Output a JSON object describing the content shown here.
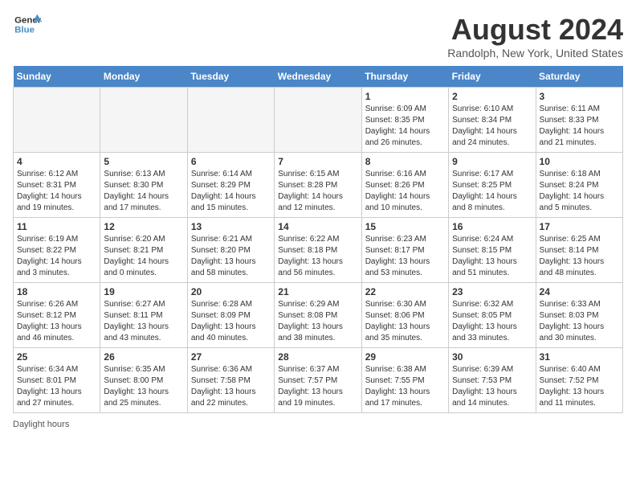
{
  "header": {
    "logo_line1": "General",
    "logo_line2": "Blue",
    "month_title": "August 2024",
    "location": "Randolph, New York, United States"
  },
  "days_of_week": [
    "Sunday",
    "Monday",
    "Tuesday",
    "Wednesday",
    "Thursday",
    "Friday",
    "Saturday"
  ],
  "weeks": [
    [
      {
        "day": "",
        "empty": true
      },
      {
        "day": "",
        "empty": true
      },
      {
        "day": "",
        "empty": true
      },
      {
        "day": "",
        "empty": true
      },
      {
        "day": "1",
        "sunrise": "6:09 AM",
        "sunset": "8:35 PM",
        "daylight": "14 hours and 26 minutes."
      },
      {
        "day": "2",
        "sunrise": "6:10 AM",
        "sunset": "8:34 PM",
        "daylight": "14 hours and 24 minutes."
      },
      {
        "day": "3",
        "sunrise": "6:11 AM",
        "sunset": "8:33 PM",
        "daylight": "14 hours and 21 minutes."
      }
    ],
    [
      {
        "day": "4",
        "sunrise": "6:12 AM",
        "sunset": "8:31 PM",
        "daylight": "14 hours and 19 minutes."
      },
      {
        "day": "5",
        "sunrise": "6:13 AM",
        "sunset": "8:30 PM",
        "daylight": "14 hours and 17 minutes."
      },
      {
        "day": "6",
        "sunrise": "6:14 AM",
        "sunset": "8:29 PM",
        "daylight": "14 hours and 15 minutes."
      },
      {
        "day": "7",
        "sunrise": "6:15 AM",
        "sunset": "8:28 PM",
        "daylight": "14 hours and 12 minutes."
      },
      {
        "day": "8",
        "sunrise": "6:16 AM",
        "sunset": "8:26 PM",
        "daylight": "14 hours and 10 minutes."
      },
      {
        "day": "9",
        "sunrise": "6:17 AM",
        "sunset": "8:25 PM",
        "daylight": "14 hours and 8 minutes."
      },
      {
        "day": "10",
        "sunrise": "6:18 AM",
        "sunset": "8:24 PM",
        "daylight": "14 hours and 5 minutes."
      }
    ],
    [
      {
        "day": "11",
        "sunrise": "6:19 AM",
        "sunset": "8:22 PM",
        "daylight": "14 hours and 3 minutes."
      },
      {
        "day": "12",
        "sunrise": "6:20 AM",
        "sunset": "8:21 PM",
        "daylight": "14 hours and 0 minutes."
      },
      {
        "day": "13",
        "sunrise": "6:21 AM",
        "sunset": "8:20 PM",
        "daylight": "13 hours and 58 minutes."
      },
      {
        "day": "14",
        "sunrise": "6:22 AM",
        "sunset": "8:18 PM",
        "daylight": "13 hours and 56 minutes."
      },
      {
        "day": "15",
        "sunrise": "6:23 AM",
        "sunset": "8:17 PM",
        "daylight": "13 hours and 53 minutes."
      },
      {
        "day": "16",
        "sunrise": "6:24 AM",
        "sunset": "8:15 PM",
        "daylight": "13 hours and 51 minutes."
      },
      {
        "day": "17",
        "sunrise": "6:25 AM",
        "sunset": "8:14 PM",
        "daylight": "13 hours and 48 minutes."
      }
    ],
    [
      {
        "day": "18",
        "sunrise": "6:26 AM",
        "sunset": "8:12 PM",
        "daylight": "13 hours and 46 minutes."
      },
      {
        "day": "19",
        "sunrise": "6:27 AM",
        "sunset": "8:11 PM",
        "daylight": "13 hours and 43 minutes."
      },
      {
        "day": "20",
        "sunrise": "6:28 AM",
        "sunset": "8:09 PM",
        "daylight": "13 hours and 40 minutes."
      },
      {
        "day": "21",
        "sunrise": "6:29 AM",
        "sunset": "8:08 PM",
        "daylight": "13 hours and 38 minutes."
      },
      {
        "day": "22",
        "sunrise": "6:30 AM",
        "sunset": "8:06 PM",
        "daylight": "13 hours and 35 minutes."
      },
      {
        "day": "23",
        "sunrise": "6:32 AM",
        "sunset": "8:05 PM",
        "daylight": "13 hours and 33 minutes."
      },
      {
        "day": "24",
        "sunrise": "6:33 AM",
        "sunset": "8:03 PM",
        "daylight": "13 hours and 30 minutes."
      }
    ],
    [
      {
        "day": "25",
        "sunrise": "6:34 AM",
        "sunset": "8:01 PM",
        "daylight": "13 hours and 27 minutes."
      },
      {
        "day": "26",
        "sunrise": "6:35 AM",
        "sunset": "8:00 PM",
        "daylight": "13 hours and 25 minutes."
      },
      {
        "day": "27",
        "sunrise": "6:36 AM",
        "sunset": "7:58 PM",
        "daylight": "13 hours and 22 minutes."
      },
      {
        "day": "28",
        "sunrise": "6:37 AM",
        "sunset": "7:57 PM",
        "daylight": "13 hours and 19 minutes."
      },
      {
        "day": "29",
        "sunrise": "6:38 AM",
        "sunset": "7:55 PM",
        "daylight": "13 hours and 17 minutes."
      },
      {
        "day": "30",
        "sunrise": "6:39 AM",
        "sunset": "7:53 PM",
        "daylight": "13 hours and 14 minutes."
      },
      {
        "day": "31",
        "sunrise": "6:40 AM",
        "sunset": "7:52 PM",
        "daylight": "13 hours and 11 minutes."
      }
    ]
  ],
  "footer": {
    "daylight_label": "Daylight hours"
  }
}
